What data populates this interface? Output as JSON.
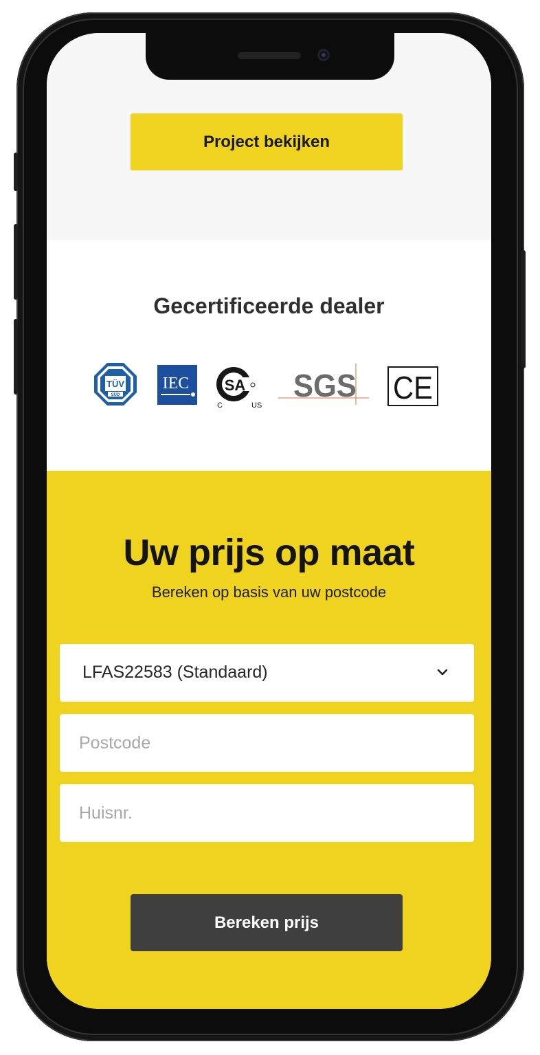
{
  "top": {
    "project_button": "Project bekijken"
  },
  "certified": {
    "title": "Gecertificeerde dealer",
    "logos": {
      "tuv": {
        "top": "TÜV",
        "bottom": "SÜD"
      },
      "iec": "IEC",
      "csa": {
        "mark": "SA",
        "c": "C",
        "us": "US"
      },
      "sgs": "SGS",
      "ce": "CE"
    }
  },
  "price": {
    "title": "Uw prijs op maat",
    "subtitle": "Bereken op basis van uw postcode",
    "product_select": "LFAS22583 (Standaard)",
    "postcode_placeholder": "Postcode",
    "housenumber_placeholder": "Huisnr.",
    "calculate_button": "Bereken prijs"
  },
  "colors": {
    "accent_yellow": "#f0d31f",
    "dark_button": "#3f3f3f",
    "page_top": "#f7f7f7"
  },
  "icons": [
    "chevron-down-icon"
  ]
}
